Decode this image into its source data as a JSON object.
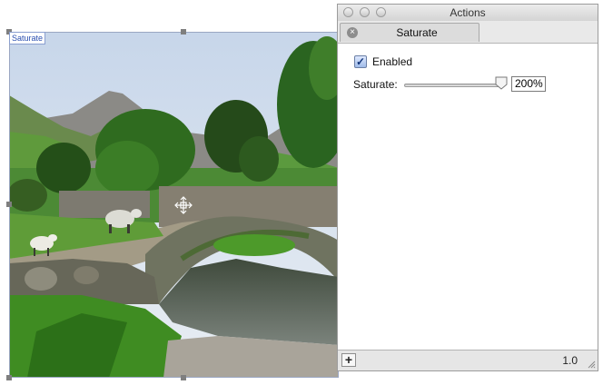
{
  "canvas": {
    "layer_tag": "Saturate",
    "image": {
      "subject": "stone-bridge-with-sheep-landscape"
    }
  },
  "panel": {
    "window_title": "Actions",
    "tab_label": "Saturate",
    "enabled_label": "Enabled",
    "enabled_checked": true,
    "saturate_label": "Saturate:",
    "saturate_value": "200%",
    "saturate_fraction": 1.0,
    "add_label": "+",
    "version": "1.0"
  },
  "icons": [
    "close-icon",
    "move-cursor-icon",
    "plus-icon",
    "resize-grip-icon"
  ]
}
